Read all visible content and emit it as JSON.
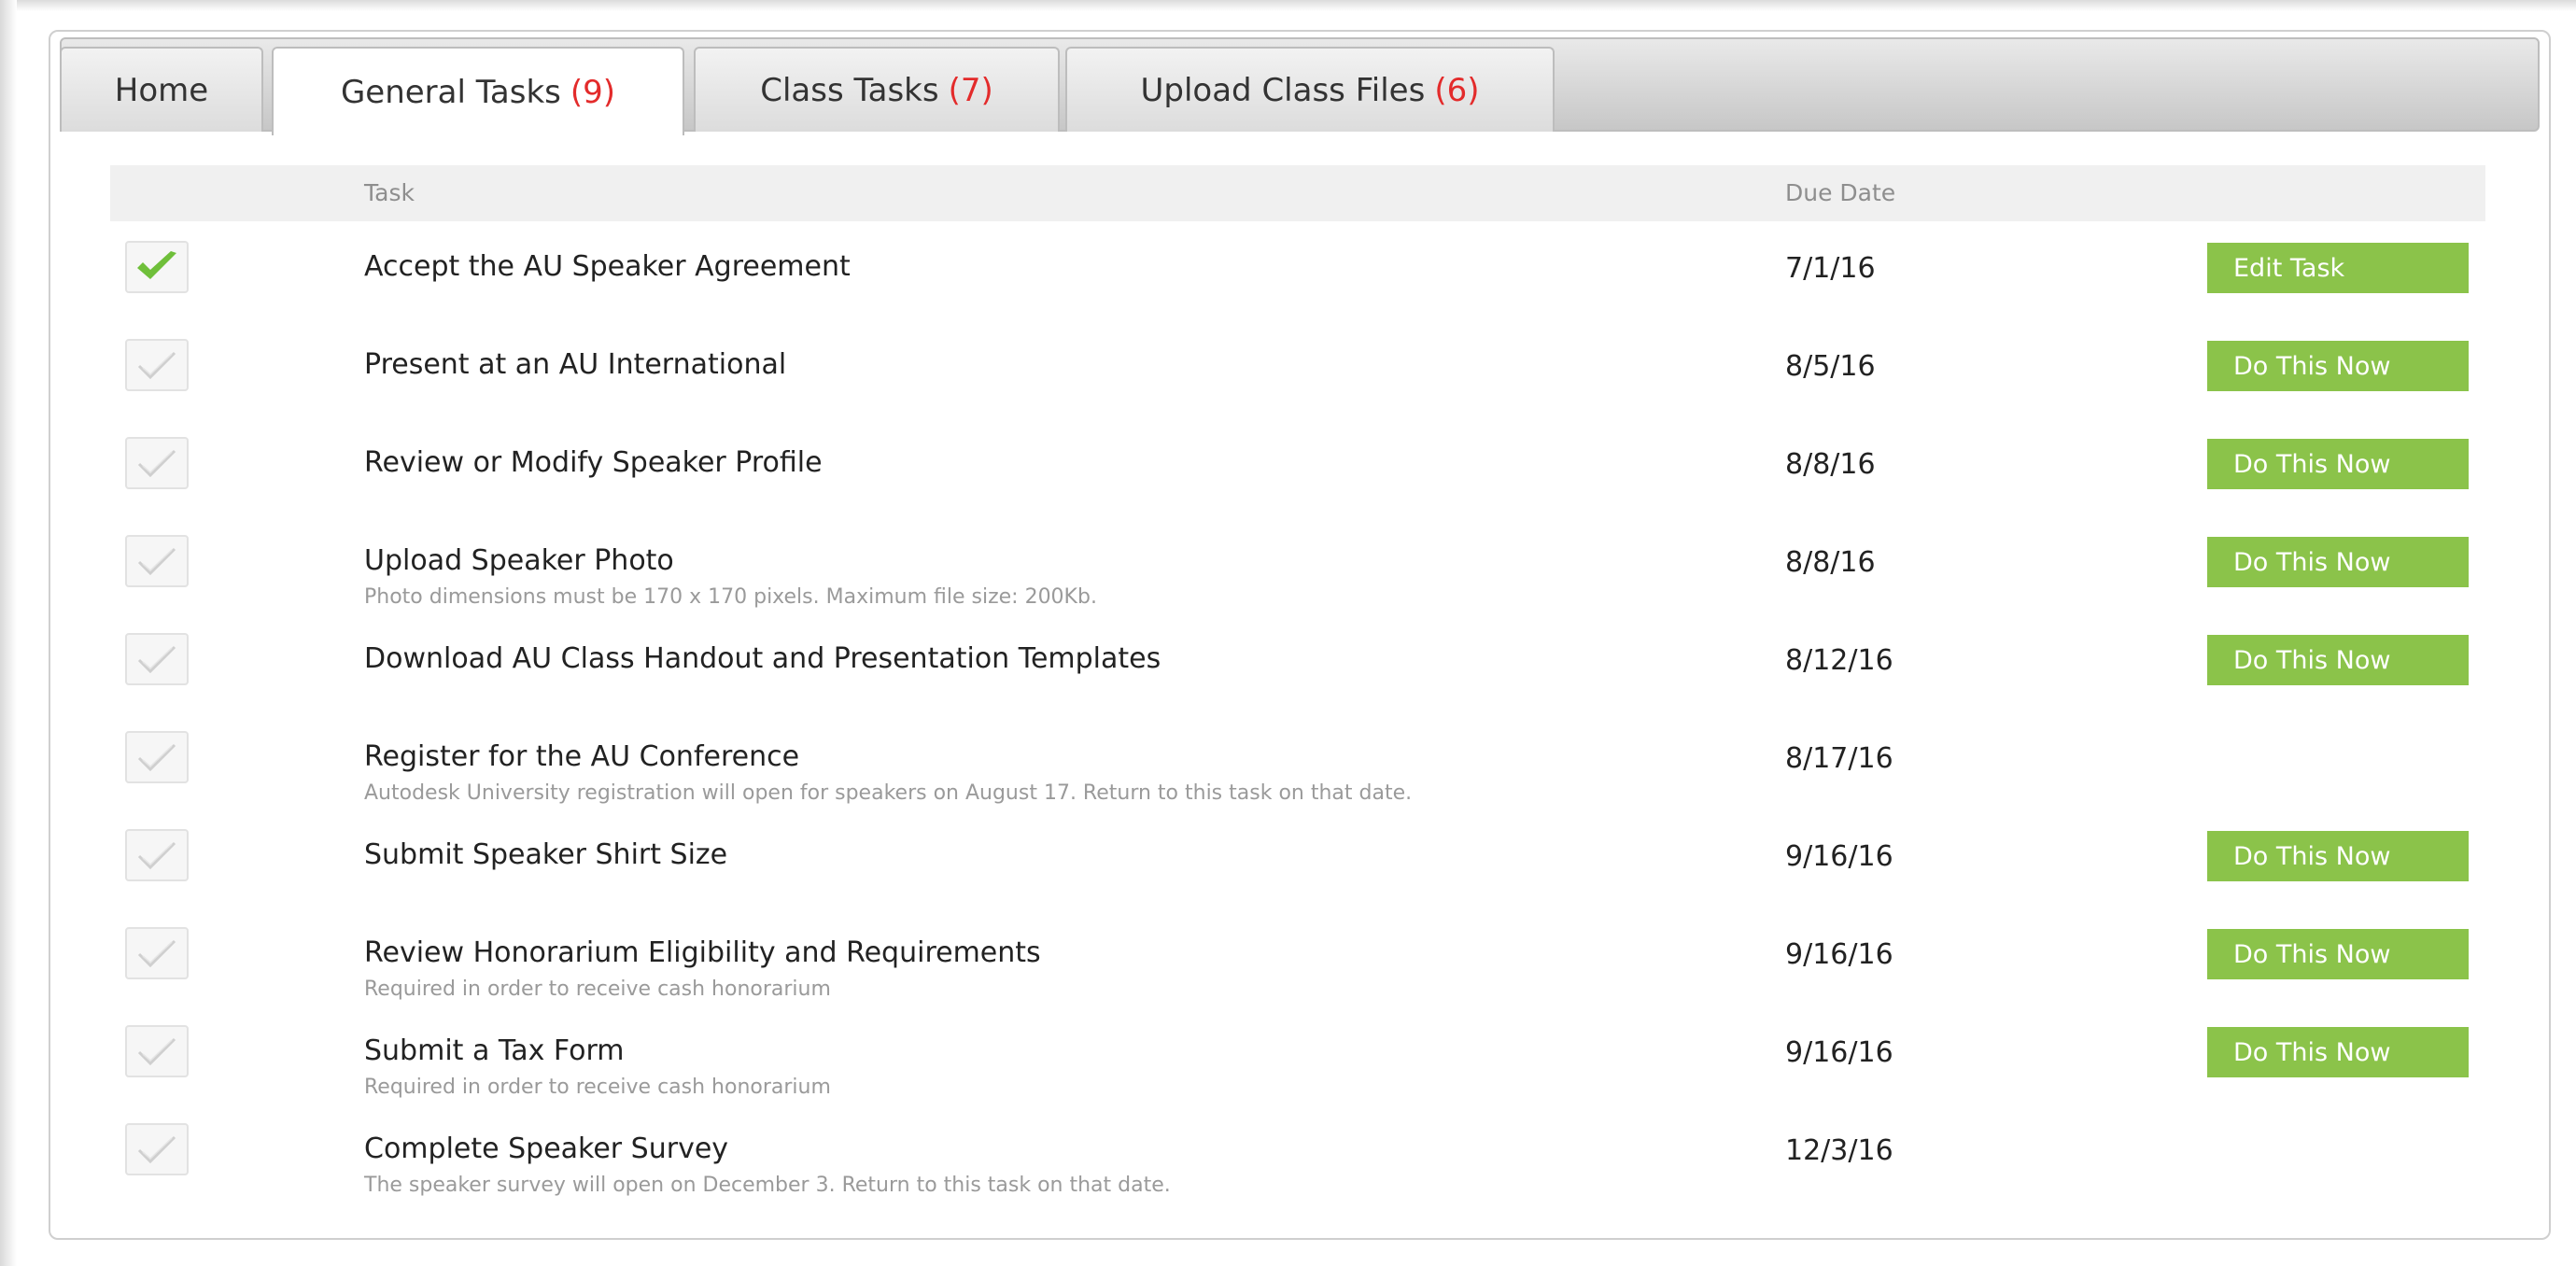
{
  "tabs": [
    {
      "label": "Home",
      "count": ""
    },
    {
      "label": "General Tasks",
      "count": "(9)"
    },
    {
      "label": "Class Tasks",
      "count": "(7)"
    },
    {
      "label": "Upload Class Files",
      "count": "(6)"
    }
  ],
  "active_tab": "General Tasks",
  "table": {
    "columns": {
      "task": "Task",
      "due_date": "Due Date"
    },
    "rows": [
      {
        "title": "Accept the AU Speaker Agreement",
        "desc": "",
        "due": "7/1/16",
        "action": "Edit Task",
        "completed": true
      },
      {
        "title": "Present at an AU International",
        "desc": "",
        "due": "8/5/16",
        "action": "Do This Now",
        "completed": false
      },
      {
        "title": "Review or Modify Speaker Profile",
        "desc": "",
        "due": "8/8/16",
        "action": "Do This Now",
        "completed": false
      },
      {
        "title": "Upload Speaker Photo",
        "desc": "Photo dimensions must be 170 x 170 pixels. Maximum file size: 200Kb.",
        "due": "8/8/16",
        "action": "Do This Now",
        "completed": false
      },
      {
        "title": "Download AU Class Handout and Presentation Templates",
        "desc": "",
        "due": "8/12/16",
        "action": "Do This Now",
        "completed": false
      },
      {
        "title": "Register for the AU Conference",
        "desc": "Autodesk University registration will open for speakers on August 17. Return to this task on that date.",
        "due": "8/17/16",
        "action": "",
        "completed": false
      },
      {
        "title": "Submit Speaker Shirt Size",
        "desc": "",
        "due": "9/16/16",
        "action": "Do This Now",
        "completed": false
      },
      {
        "title": "Review Honorarium Eligibility and Requirements",
        "desc": "Required in order to receive cash honorarium",
        "due": "9/16/16",
        "action": "Do This Now",
        "completed": false
      },
      {
        "title": "Submit a Tax Form",
        "desc": "Required in order to receive cash honorarium",
        "due": "9/16/16",
        "action": "Do This Now",
        "completed": false
      },
      {
        "title": "Complete Speaker Survey",
        "desc": "The speaker survey will open on December 3. Return to this task on that date.",
        "due": "12/3/16",
        "action": "",
        "completed": false
      }
    ]
  },
  "colors": {
    "accent_green": "#8bc34a",
    "count_red": "#e32b2b",
    "check_done": "#6fbf3a",
    "check_pending": "#cfcfcf"
  }
}
